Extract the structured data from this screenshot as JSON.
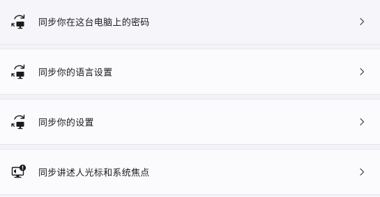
{
  "settings_list": {
    "items": [
      {
        "label": "同步你在这台电脑上的密码",
        "icon": "sync-pc-icon"
      },
      {
        "label": "同步你的语言设置",
        "icon": "sync-pc-icon"
      },
      {
        "label": "同步你的设置",
        "icon": "sync-pc-icon"
      },
      {
        "label": "同步讲述人光标和系统焦点",
        "icon": "narrator-monitor-icon"
      }
    ],
    "chevron_icon": "chevron-right-icon"
  },
  "colors": {
    "page_background": "#f3f3f7",
    "row_background": "#fbfbfd",
    "row_border": "#e5e6ee",
    "text": "#1b1b1b",
    "icon": "#1b1b1b"
  }
}
